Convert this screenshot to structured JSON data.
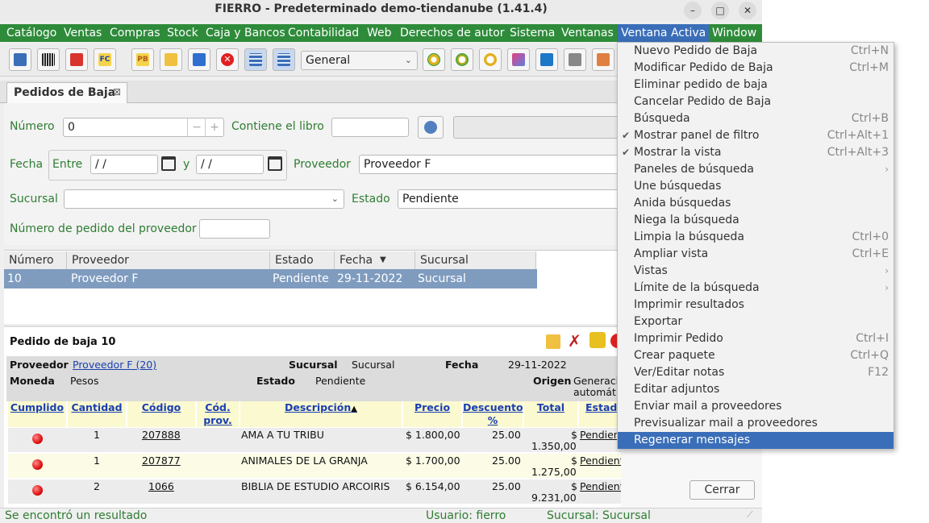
{
  "window": {
    "title": "FIERRO - Predeterminado demo-tiendanube (1.41.4)",
    "minimize": "–",
    "maximize": "□",
    "close": "✕"
  },
  "menubar": [
    "Catálogo",
    "Ventas",
    "Compras",
    "Stock",
    "Caja y Bancos",
    "Contabilidad",
    "Web",
    "Derechos de autor",
    "Sistema",
    "Ventanas",
    "Ventana Activa",
    "Window"
  ],
  "toolbar": {
    "combo_value": "General"
  },
  "tab": {
    "label": "Pedidos de Baja",
    "close": "⊠"
  },
  "filter": {
    "numero_label": "Número",
    "numero_value": "0",
    "minus": "−",
    "plus": "+",
    "contiene_label": "Contiene el libro",
    "fecha_label": "Fecha",
    "entre_label": "Entre",
    "fecha_desde": " / /",
    "y_label": "y",
    "fecha_hasta": " / /",
    "proveedor_label": "Proveedor",
    "proveedor_value": "Proveedor F",
    "sucursal_label": "Sucursal",
    "sucursal_value": "",
    "estado_label": "Estado",
    "estado_value": "Pendiente",
    "nro_pedido_label": "Número de pedido del proveedor"
  },
  "results": {
    "headers": [
      "Número",
      "Proveedor",
      "Estado",
      "Fecha",
      "Sucursal"
    ],
    "sort_arrow": "▼",
    "rows": [
      [
        "10",
        "Proveedor F",
        "Pendiente",
        "29-11-2022",
        "Sucursal"
      ]
    ]
  },
  "detail": {
    "title": "Pedido de baja 10",
    "proveedor_label": "Proveedor",
    "proveedor_value": "Proveedor F (20)",
    "sucursal_label": "Sucursal",
    "sucursal_value": "Sucursal",
    "fecha_label": "Fecha",
    "fecha_value": "29-11-2022",
    "moneda_label": "Moneda",
    "moneda_value": "Pesos",
    "estado_label": "Estado",
    "estado_value": "Pendiente",
    "origen_label": "Origen",
    "origen_value_1": "Generacio",
    "origen_value_2": "automáti",
    "col_headers": {
      "cumplido": "Cumplido",
      "cantidad": "Cantidad",
      "codigo": "Código",
      "cod_prov_1": "Cód.",
      "cod_prov_2": "prov.",
      "descripcion": "Descripción",
      "desc_arrow": "▲",
      "precio": "Precio",
      "descuento_1": "Descuento",
      "descuento_2": "%",
      "total": "Total",
      "estado": "Estad"
    },
    "items": [
      {
        "cantidad": "1",
        "codigo": "207888",
        "descripcion": "AMA A TU TRIBU",
        "precio": "$ 1.800,00",
        "descuento": "25.00",
        "total_sym": "$",
        "total": "1.350,00",
        "estado": "Pendiente"
      },
      {
        "cantidad": "1",
        "codigo": "207877",
        "descripcion": "ANIMALES DE LA GRANJA",
        "precio": "$ 1.700,00",
        "descuento": "25.00",
        "total_sym": "$",
        "total": "1.275,00",
        "estado": "Pendiente"
      },
      {
        "cantidad": "2",
        "codigo": "1066",
        "descripcion": "BIBLIA DE ESTUDIO ARCOIRIS",
        "precio": "$ 6.154,00",
        "descuento": "25.00",
        "total_sym": "$",
        "total": "9.231,00",
        "estado": "Pendiente"
      }
    ],
    "cerrar": "Cerrar"
  },
  "statusbar": {
    "message": "Se encontró un resultado",
    "usuario": "Usuario: fierro",
    "sucursal": "Sucursal: Sucursal"
  },
  "dropdown": {
    "items": [
      {
        "label": "Nuevo Pedido de Baja",
        "shortcut": "Ctrl+N"
      },
      {
        "label": "Modificar Pedido de Baja",
        "shortcut": "Ctrl+M"
      },
      {
        "label": "Eliminar pedido de baja",
        "shortcut": ""
      },
      {
        "label": "Cancelar Pedido de Baja",
        "shortcut": ""
      },
      {
        "label": "Búsqueda",
        "shortcut": "Ctrl+B"
      },
      {
        "label": "Mostrar panel de filtro",
        "shortcut": "Ctrl+Alt+1",
        "check": "✔"
      },
      {
        "label": "Mostrar la vista",
        "shortcut": "Ctrl+Alt+3",
        "check": "✔"
      },
      {
        "label": "Paneles de búsqueda",
        "shortcut": "",
        "arrow": "›"
      },
      {
        "label": "Une búsquedas",
        "shortcut": ""
      },
      {
        "label": "Anida búsquedas",
        "shortcut": ""
      },
      {
        "label": "Niega la búsqueda",
        "shortcut": ""
      },
      {
        "label": "Limpia la búsqueda",
        "shortcut": "Ctrl+0"
      },
      {
        "label": "Ampliar vista",
        "shortcut": "Ctrl+E"
      },
      {
        "label": "Vistas",
        "shortcut": "",
        "arrow": "›"
      },
      {
        "label": "Límite de la búsqueda",
        "shortcut": "",
        "arrow": "›"
      },
      {
        "label": "Imprimir resultados",
        "shortcut": ""
      },
      {
        "label": "Exportar",
        "shortcut": ""
      },
      {
        "label": "Imprimir Pedido",
        "shortcut": "Ctrl+I"
      },
      {
        "label": "Crear paquete",
        "shortcut": "Ctrl+Q"
      },
      {
        "label": "Ver/Editar notas",
        "shortcut": "F12"
      },
      {
        "label": "Editar adjuntos",
        "shortcut": ""
      },
      {
        "label": "Enviar mail a proveedores",
        "shortcut": ""
      },
      {
        "label": "Previsualizar mail a proveedores",
        "shortcut": ""
      },
      {
        "label": "Regenerar mensajes",
        "shortcut": ""
      }
    ],
    "highlighted_index": 23,
    "highlight_color": "#3a6eb8"
  },
  "colors": {
    "menubar": "#2e8b3a",
    "label_green": "#2e7d32",
    "selected_row": "#7f9cbf",
    "link_blue": "#1a3fb0"
  }
}
